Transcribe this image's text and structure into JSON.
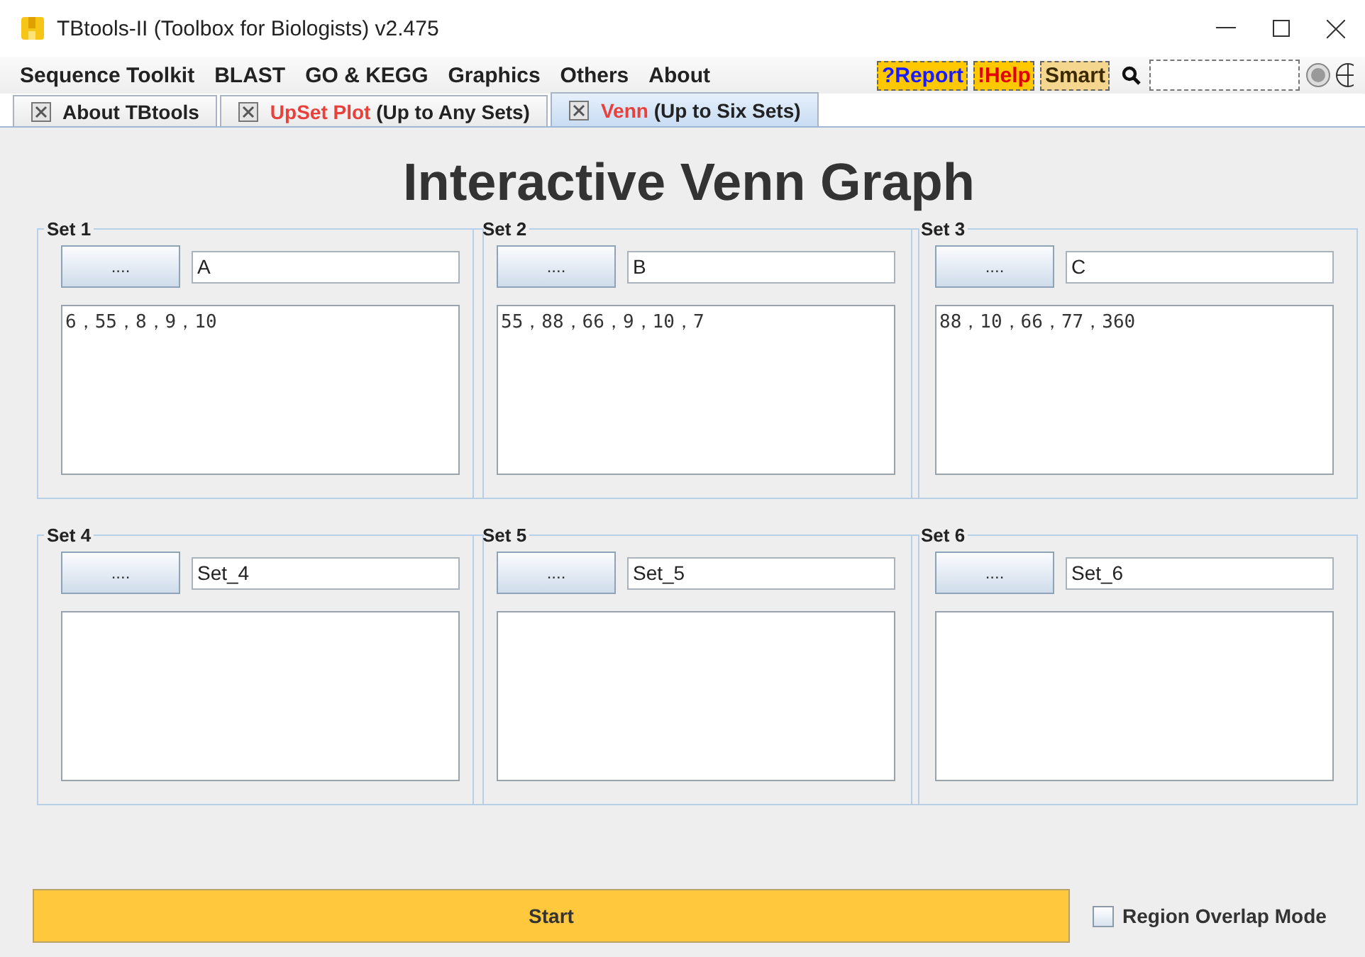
{
  "window": {
    "title": "TBtools-II (Toolbox for Biologists) v2.475"
  },
  "menu": [
    "Sequence Toolkit",
    "BLAST",
    "GO & KEGG",
    "Graphics",
    "Others",
    "About"
  ],
  "toolbar_buttons": [
    {
      "label": "?Report",
      "kind": "report"
    },
    {
      "label": "!Help",
      "kind": "help"
    },
    {
      "label": "Smart",
      "kind": "smart"
    }
  ],
  "tabs": [
    {
      "label": "About TBtools",
      "selected": false
    },
    {
      "accent": "UpSet Plot",
      "label": "(Up to Any Sets)",
      "selected": false
    },
    {
      "accent": "Venn",
      "label": "(Up to Six Sets)",
      "selected": true
    }
  ],
  "heading": "Interactive Venn Graph",
  "sets": [
    {
      "title": "Set 1",
      "button": "....",
      "name": "A",
      "items": "6，55，8，9，10"
    },
    {
      "title": "Set 2",
      "button": "....",
      "name": "B",
      "items": "55，88，66，9，10，7"
    },
    {
      "title": "Set 3",
      "button": "....",
      "name": "C",
      "items": "88，10，66，77，360"
    },
    {
      "title": "Set 4",
      "button": "....",
      "name": "Set_4"
    },
    {
      "title": "Set 5",
      "button": "....",
      "name": "Set_5"
    },
    {
      "title": "Set 6",
      "button": "....",
      "name": "Set_6"
    }
  ],
  "start_button": "Start",
  "region_overlap": {
    "label": "Region Overlap Mode",
    "checked": false
  }
}
